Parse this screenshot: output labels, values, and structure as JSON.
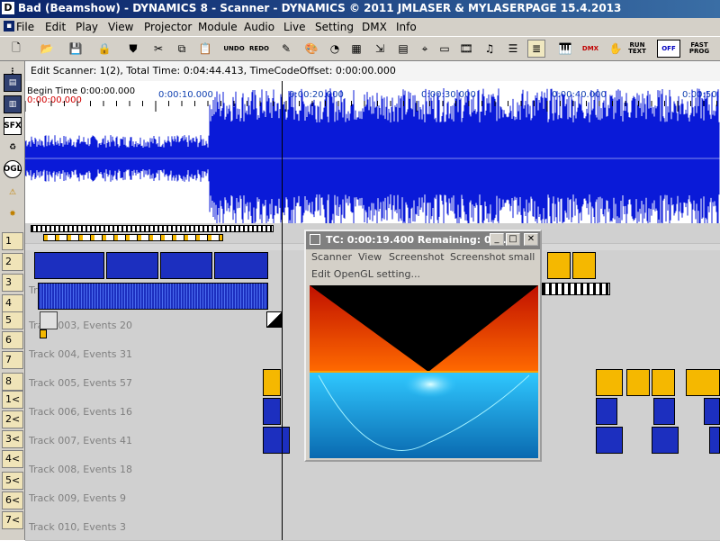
{
  "window": {
    "title": "Bad (Beamshow) - DYNAMICS 8 - Scanner - DYNAMICS © 2011 JMLASER & MYLASERPAGE 15.4.2013",
    "app_icon": "D"
  },
  "menu": {
    "items": [
      "File",
      "Edit",
      "Play",
      "View",
      "Projector",
      "Module",
      "Audio",
      "Live",
      "Setting",
      "DMX",
      "Info"
    ]
  },
  "toolbar": {
    "undo": "UNDO",
    "redo": "REDO",
    "dmx": "DMX",
    "run_text": "RUN TEXT",
    "off": "OFF",
    "fast_prog": "FAST PROG"
  },
  "left_palette": {
    "sfx": "SFX",
    "ogl": "OGL"
  },
  "info_line": "Edit Scanner: 1(2), Total Time: 0:04:44.413, TimeCodeOffset: 0:00:00.000",
  "ruler": {
    "begin_time": "Begin Time 0:00:00.000",
    "start": "0:00:00.000",
    "marks": [
      "0:00:10.000",
      "0:00:20.000",
      "0:00:30.000",
      "0:00:40.000",
      "0:00:50."
    ]
  },
  "track_numbers": [
    "1",
    "2",
    "3",
    "4",
    "5",
    "6",
    "7",
    "8",
    "1<",
    "2<",
    "3<",
    "4<",
    "5<",
    "6<",
    "7<"
  ],
  "tracks": [
    "Track 003, Events 20",
    "Track 004, Events 31",
    "Track 005, Events 57",
    "Track 006, Events 16",
    "Track 007, Events 41",
    "Track 008, Events 18",
    "Track 009, Events 9",
    "Track 010, Events 3"
  ],
  "track3_prefix": "Tr",
  "popup": {
    "title": "TC: 0:00:19.400  Remaining: 0:...",
    "menu": [
      "Scanner",
      "View",
      "Screenshot",
      "Screenshot small"
    ],
    "menu2": "Edit OpenGL setting..."
  },
  "colors": {
    "waveform": "#0a1ad8",
    "event_blue": "#1c2fbf",
    "event_yellow": "#f5b800",
    "title_bar": "#0a246a"
  }
}
